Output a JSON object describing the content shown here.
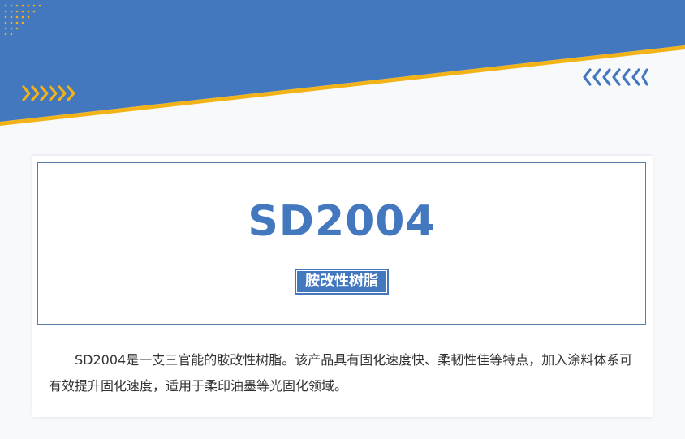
{
  "product": {
    "code": "SD2004",
    "category_badge": "胺改性树脂",
    "description": "SD2004是一支三官能的胺改性树脂。该产品具有固化速度快、柔韧性佳等特点，加入涂料体系可有效提升固化速度，适用于柔印油墨等光固化领域。"
  },
  "colors": {
    "brand_blue": "#4378bf",
    "accent_yellow": "#f2b319",
    "frame_border": "#5a7ea8",
    "body_text": "#333333"
  },
  "decorations": {
    "top_left_icon": "dot-grid-icon",
    "left_arrows_icon": "chevrons-right-icon",
    "right_arrows_icon": "chevrons-left-icon"
  }
}
